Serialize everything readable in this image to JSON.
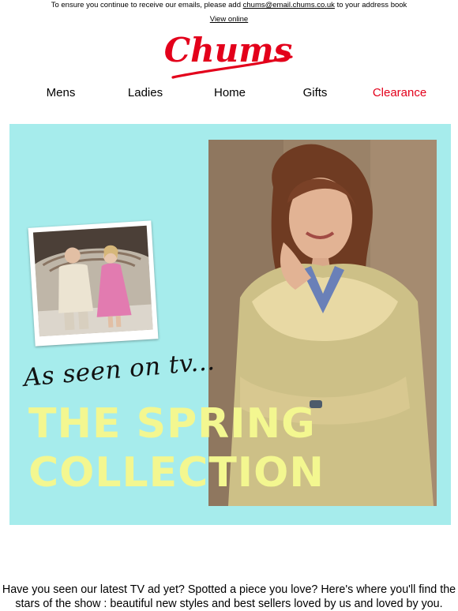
{
  "preheader": {
    "text_before": "To ensure you continue to receive our emails, please add ",
    "email": "chums@email.chums.co.uk",
    "text_after": " to your address book",
    "view_online": "View online"
  },
  "brand": {
    "logo_text": "Chums",
    "color": "#e3001b"
  },
  "nav": {
    "items": [
      {
        "label": "Mens"
      },
      {
        "label": "Ladies"
      },
      {
        "label": "Home"
      },
      {
        "label": "Gifts"
      },
      {
        "label": "Clearance"
      }
    ],
    "highlight_color": "#e3001b"
  },
  "hero": {
    "background_color": "#a6ecec",
    "script_line": "As seen on tv...",
    "headline_line1": "THE SPRING",
    "headline_line2": "COLLECTION",
    "headline_color": "#f3f790"
  },
  "intro": {
    "text": "Have you seen our latest TV ad yet? Spotted a piece you love? Here's where you'll find the stars of the show : beautiful new styles and best sellers loved by us and loved by you."
  }
}
